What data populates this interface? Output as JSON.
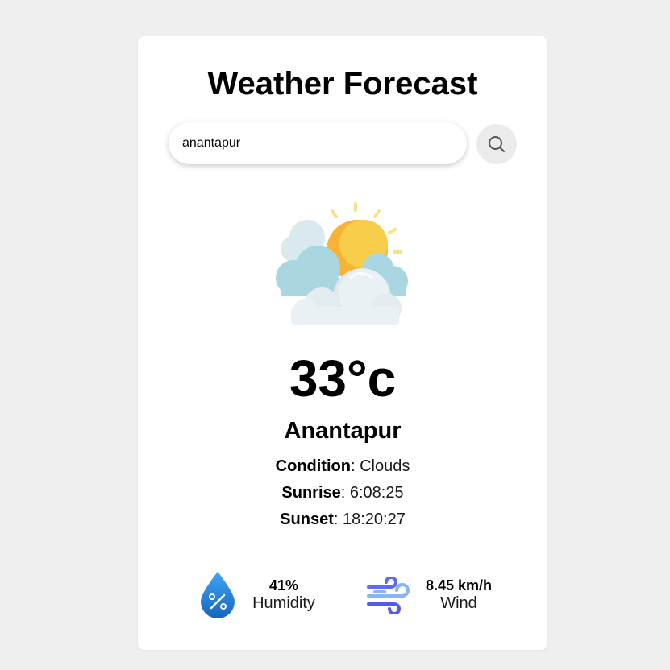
{
  "header": {
    "title": "Weather Forecast"
  },
  "search": {
    "value": "anantapur",
    "button_icon": "search-icon"
  },
  "weather": {
    "icon": "sun-behind-clouds-icon",
    "temperature": "33°c",
    "city": "Anantapur",
    "condition_label": "Condition",
    "condition_value": ": Clouds",
    "sunrise_label": "Sunrise",
    "sunrise_value": ": 6:08:25",
    "sunset_label": "Sunset",
    "sunset_value": ": 18:20:27"
  },
  "stats": {
    "humidity": {
      "icon": "humidity-drop-icon",
      "value": "41%",
      "label": "Humidity"
    },
    "wind": {
      "icon": "wind-icon",
      "value": "8.45 km/h",
      "label": "Wind"
    }
  },
  "colors": {
    "background": "#efefef",
    "card": "#ffffff",
    "sun": "#f9b233",
    "cloud": "#a9d6e0",
    "humidity_blue": "#1e88e5",
    "wind_blue": "#4f7cf5"
  }
}
